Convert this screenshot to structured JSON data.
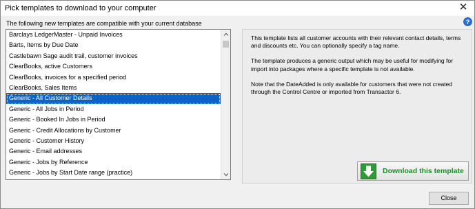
{
  "window": {
    "title": "Pick templates to download to your computer",
    "close_glyph": "✕"
  },
  "subtitle": "The following new templates are compatible with your current database",
  "templates": [
    "Barclays LedgerMaster - Unpaid Invoices",
    "Barts, Items by Due Date",
    "Castlebawn Sage audit trail, customer invoices",
    "ClearBooks, active Customers",
    "ClearBooks, invoices for a specified period",
    "ClearBooks, Sales Items",
    "Generic - All Customer Details",
    "Generic - All Jobs in Period",
    "Generic - Booked In Jobs in Period",
    "Generic - Credit Allocations by Customer",
    "Generic - Customer History",
    "Generic - Email addresses",
    "Generic - Jobs by Reference",
    "Generic - Jobs by Start Date range (practice)"
  ],
  "selected_template": "Generic - All Customer Details",
  "description": {
    "paragraphs": [
      "This template lists all customer accounts with their relevant contact details, terms and discounts etc. You can optionally specify a tag name.",
      "The template produces a generic output which may be useful for modifying for import into packages where a specific template is not available.",
      "Note that the DateAdded is only available for customers that were not created through the Control Centre or imported from Transactor 6."
    ]
  },
  "download_button": {
    "label": "Download this template"
  },
  "close_button": {
    "label": "Close"
  },
  "icons": {
    "help": "help-icon",
    "download": "download-arrow-icon",
    "scroll_up": "scroll-up-icon",
    "scroll_down": "scroll-down-icon"
  },
  "colors": {
    "selection": "#0a64c8",
    "download_green": "#1f8a26",
    "help_blue": "#2a6fdb"
  }
}
